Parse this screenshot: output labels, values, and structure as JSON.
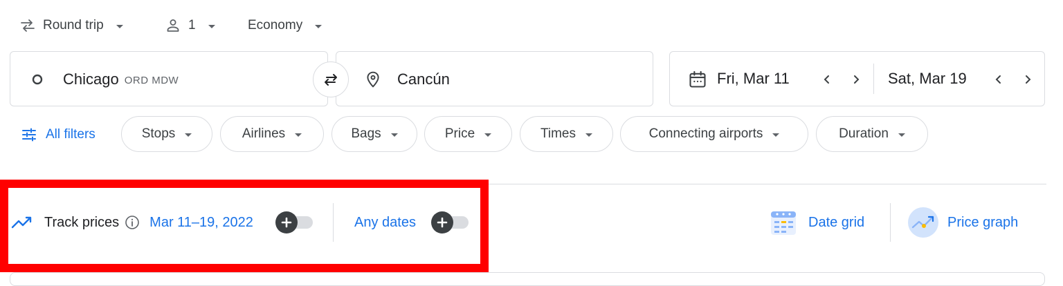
{
  "trip_options": {
    "trip_type": "Round trip",
    "passengers": "1",
    "cabin_class": "Economy"
  },
  "search": {
    "origin": "Chicago",
    "origin_codes": "ORD MDW",
    "destination": "Cancún",
    "depart_date": "Fri, Mar 11",
    "return_date": "Sat, Mar 19"
  },
  "filters": {
    "all_filters": "All filters",
    "chips": [
      "Stops",
      "Airlines",
      "Bags",
      "Price",
      "Times",
      "Connecting airports",
      "Duration"
    ]
  },
  "tracker": {
    "label": "Track prices",
    "date_range": "Mar 11–19, 2022",
    "any_dates": "Any dates"
  },
  "views": {
    "date_grid": "Date grid",
    "price_graph": "Price graph"
  },
  "colors": {
    "accent": "#1a73e8",
    "highlight_frame": "#ff0000",
    "border": "#dadce0",
    "text": "#3c4043"
  },
  "icons": {
    "swap": "swap-arrows-icon",
    "person": "person-icon",
    "origin": "circle-icon",
    "destination": "location-pin-icon",
    "calendar": "calendar-icon",
    "filters": "tune-icon",
    "trend": "trending-icon",
    "info": "info-icon"
  }
}
